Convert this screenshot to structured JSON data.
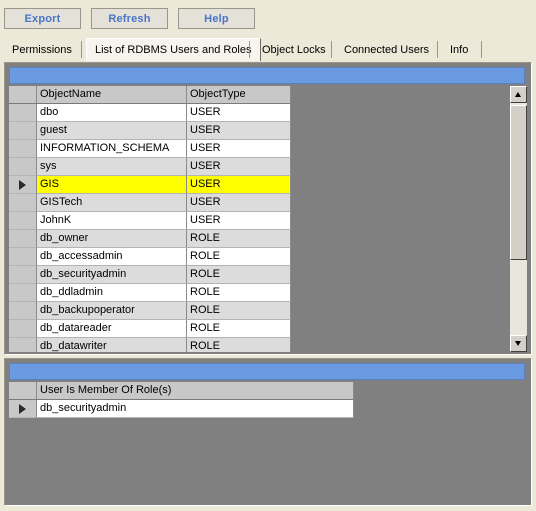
{
  "toolbar": {
    "buttons": [
      {
        "id": "export",
        "label": "Export"
      },
      {
        "id": "refresh",
        "label": "Refresh"
      },
      {
        "id": "help",
        "label": "Help"
      }
    ]
  },
  "tabs": [
    {
      "label": "Permissions",
      "active": false
    },
    {
      "label": "List of RDBMS Users and Roles",
      "active": true
    },
    {
      "label": "Object Locks",
      "active": false
    },
    {
      "label": "Connected Users",
      "active": false
    },
    {
      "label": "Info",
      "active": false
    }
  ],
  "users_grid": {
    "columns": [
      "ObjectName",
      "ObjectType"
    ],
    "rows": [
      {
        "name": "dbo",
        "type": "USER",
        "selected": false
      },
      {
        "name": "guest",
        "type": "USER",
        "selected": false
      },
      {
        "name": "INFORMATION_SCHEMA",
        "type": "USER",
        "selected": false
      },
      {
        "name": "sys",
        "type": "USER",
        "selected": false
      },
      {
        "name": "GIS",
        "type": "USER",
        "selected": true
      },
      {
        "name": "GISTech",
        "type": "USER",
        "selected": false
      },
      {
        "name": "JohnK",
        "type": "USER",
        "selected": false
      },
      {
        "name": "db_owner",
        "type": "ROLE",
        "selected": false
      },
      {
        "name": "db_accessadmin",
        "type": "ROLE",
        "selected": false
      },
      {
        "name": "db_securityadmin",
        "type": "ROLE",
        "selected": false
      },
      {
        "name": "db_ddladmin",
        "type": "ROLE",
        "selected": false
      },
      {
        "name": "db_backupoperator",
        "type": "ROLE",
        "selected": false
      },
      {
        "name": "db_datareader",
        "type": "ROLE",
        "selected": false
      },
      {
        "name": "db_datawriter",
        "type": "ROLE",
        "selected": false
      }
    ]
  },
  "roles_grid": {
    "columns": [
      "User Is Member Of Role(s)"
    ],
    "rows": [
      {
        "role": "db_securityadmin",
        "selected": true
      }
    ]
  },
  "colors": {
    "caption_blue": "#6a9be2",
    "selection_yellow": "#ffff00",
    "button_text": "#4a74c8",
    "panel_gray": "#808080"
  },
  "icons": {
    "scroll_up": "scroll-up-arrow-icon",
    "scroll_down": "scroll-down-arrow-icon",
    "row_marker": "row-selector-arrow-icon"
  }
}
